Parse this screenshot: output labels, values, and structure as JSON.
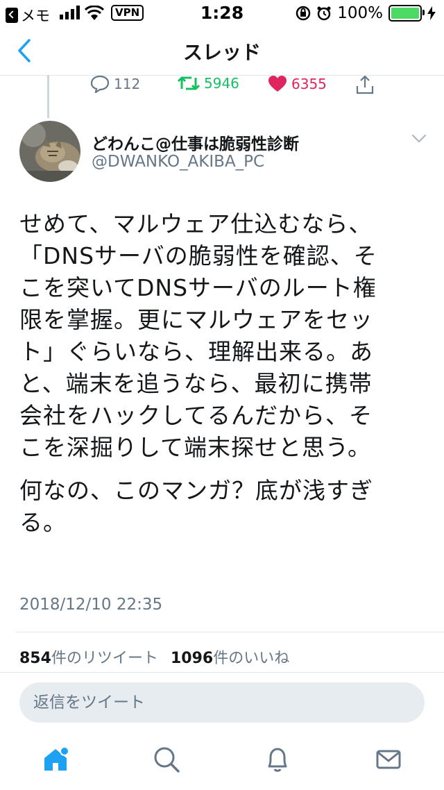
{
  "status_bar": {
    "back_app": "メモ",
    "vpn": "VPN",
    "time": "1:28",
    "battery": "100%"
  },
  "nav": {
    "title": "スレッド"
  },
  "prev_tweet": {
    "replies": "112",
    "retweets": "5946",
    "likes": "6355"
  },
  "tweet": {
    "author_name": "どわんこ@仕事は脆弱性診断",
    "author_handle": "@DWANKO_AKIBA_PC",
    "body_lines": [
      "せめて、マルウェア仕込むなら、",
      "「DNSサーバの脆弱性を確認、そ",
      "こを突いてDNSサーバのルート権",
      "限を掌握。更にマルウェアをセッ",
      "ト」ぐらいなら、理解出来る。あ",
      "と、端末を追うなら、最初に携帯",
      "会社をハックしてるんだから、そ",
      "こを深掘りして端末探せと思う。"
    ],
    "body_lines_2": [
      "何なの、このマンガ？底が浅すぎ",
      "る。"
    ],
    "timestamp": "2018/12/10 22:35",
    "retweet_count": "854",
    "retweet_label": "件のリツイート",
    "like_count": "1096",
    "like_label": "件のいいね"
  },
  "reply": {
    "placeholder": "返信をツイート"
  },
  "colors": {
    "accent": "#1da1f2",
    "retweet": "#17bf63",
    "like": "#e0245e",
    "muted": "#657786"
  },
  "icons": [
    "back-chevron-icon",
    "reply-icon",
    "retweet-icon",
    "heart-icon",
    "share-icon",
    "caret-down-icon",
    "home-icon",
    "search-icon",
    "bell-icon",
    "mail-icon"
  ]
}
